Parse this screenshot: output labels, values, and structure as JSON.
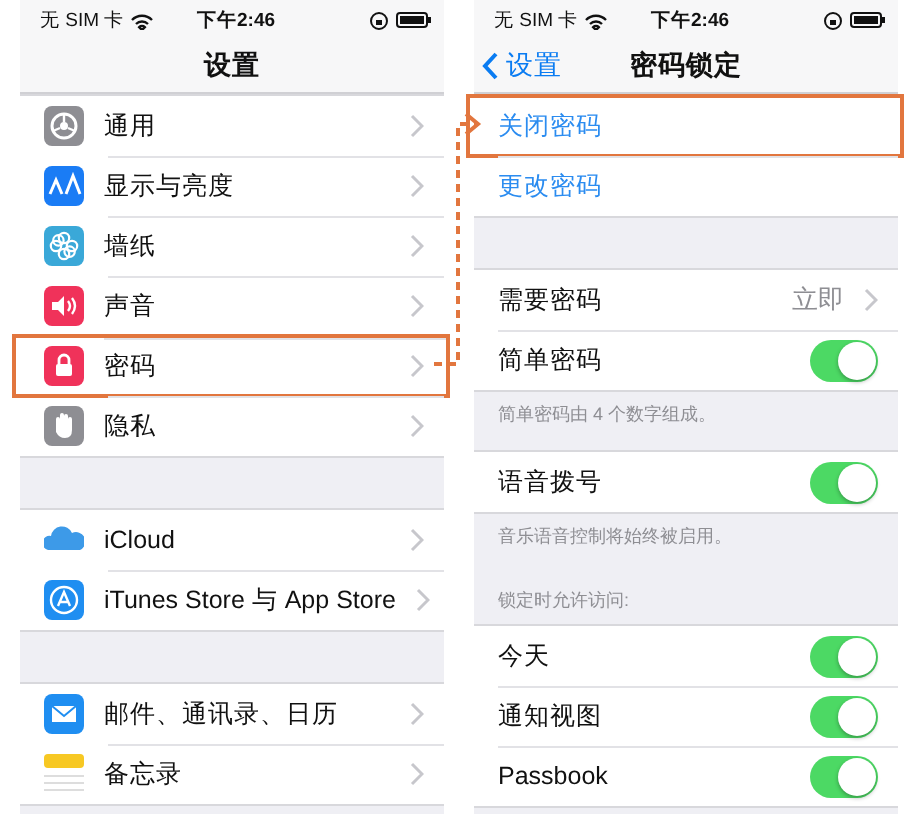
{
  "left_screen": {
    "status_bar": {
      "carrier": "无 SIM 卡",
      "time": "下午2:46"
    },
    "title": "设置",
    "groups": [
      {
        "rows": [
          {
            "kind": "link",
            "label": "通用",
            "color": "#8e8e93",
            "highlighted": false
          },
          {
            "kind": "link",
            "label": "显示与亮度",
            "color": "#1a7cf5",
            "highlighted": false
          },
          {
            "kind": "link",
            "label": "墙纸",
            "color": "#3aa8d8",
            "highlighted": false
          },
          {
            "kind": "link",
            "label": "声音",
            "color": "#f0325a",
            "highlighted": false
          },
          {
            "kind": "link",
            "label": "密码",
            "color": "#f0325a",
            "highlighted": true
          },
          {
            "kind": "link",
            "label": "隐私",
            "color": "#8e8e93",
            "highlighted": false
          }
        ]
      },
      {
        "rows": [
          {
            "kind": "link",
            "label": "iCloud",
            "color": "#3d9ae8",
            "highlighted": false
          },
          {
            "kind": "link",
            "label": "iTunes Store 与 App Store",
            "color": "#1f8ef1",
            "highlighted": false
          }
        ]
      },
      {
        "rows": [
          {
            "kind": "link",
            "label": "邮件、通讯录、日历",
            "color": "#1f8ef1",
            "highlighted": false
          },
          {
            "kind": "link",
            "label": "备忘录",
            "color": "#f7c823",
            "highlighted": false
          }
        ]
      }
    ]
  },
  "right_screen": {
    "status_bar": {
      "carrier": "无 SIM 卡",
      "time": "下午2:46"
    },
    "back": "设置",
    "title": "密码锁定",
    "groups": [
      {
        "rows": [
          {
            "kind": "action",
            "label": "关闭密码",
            "highlighted": true
          },
          {
            "kind": "action",
            "label": "更改密码",
            "highlighted": false
          }
        ]
      },
      {
        "rows": [
          {
            "kind": "value",
            "label": "需要密码",
            "value": "立即",
            "highlighted": false
          },
          {
            "kind": "toggle",
            "label": "简单密码",
            "on": true,
            "highlighted": false
          }
        ],
        "footer": "简单密码由 4 个数字组成。"
      },
      {
        "rows": [
          {
            "kind": "toggle",
            "label": "语音拨号",
            "on": true,
            "highlighted": false
          }
        ],
        "footer": "音乐语音控制将始终被启用。"
      },
      {
        "header": "锁定时允许访问:",
        "rows": [
          {
            "kind": "toggle",
            "label": "今天",
            "on": true,
            "highlighted": false
          },
          {
            "kind": "toggle",
            "label": "通知视图",
            "on": true,
            "highlighted": false
          },
          {
            "kind": "toggle",
            "label": "Passbook",
            "on": true,
            "highlighted": false
          }
        ]
      }
    ]
  }
}
